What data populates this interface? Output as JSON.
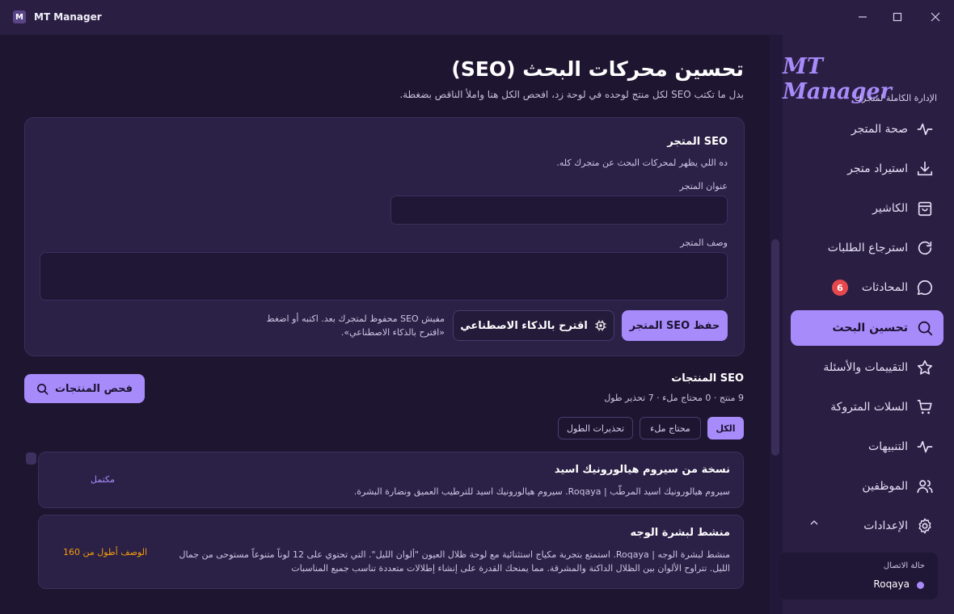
{
  "window": {
    "app_title": "MT Manager",
    "logo_letter": "M",
    "min_glyph": "—",
    "max_glyph": "☐",
    "close_glyph": "✕"
  },
  "page": {
    "title": "تحسين محركات البحث (SEO)",
    "subtitle": "بدل ما تكتب SEO لكل منتج لوحده في لوحة زد، افحص الكل هنا واملأ الناقص بضغطة."
  },
  "store_seo": {
    "title": "SEO المتجر",
    "description": "ده اللي يظهر لمحركات البحث عن متجرك كله.",
    "store_title_label": "عنوان المتجر",
    "store_title_value": "",
    "store_desc_label": "وصف المتجر",
    "store_desc_value": "",
    "save_button": "حفظ SEO المتجر",
    "ai_button": "اقترح بالذكاء الاصطناعي",
    "hint": "مفيش SEO محفوظ لمتجرك بعد. اكتبه أو اضغط «اقترح بالذكاء الاصطناعي»."
  },
  "products_seo": {
    "title": "SEO المنتجات",
    "stats": "9 منتج · 0 محتاج ملء · 7 تحذير طول",
    "scan_button": "فحص المنتجات",
    "filters": [
      "الكل",
      "محتاج ملء",
      "تحذيرات الطول"
    ],
    "active_filter": "الكل",
    "items": [
      {
        "title": "نسخة من سيروم هيالورونيك اسيد",
        "desc": "سيروم هيالورونيك اسيد المرطّب | Roqaya. سيروم هيالورونيك اسيد للترطيب العميق ونضارة البشرة.",
        "status": "مكتمل"
      },
      {
        "title": "منشط لبشرة الوجه",
        "desc": "منشط لبشرة الوجه | Roqaya. استمتع بتجربة مكياج استثنائية مع لوحة ظلال العيون \"ألوان الليل\". التي تحتوي على 12 لوناً متنوعاً مستوحى من جمال الليل. تتراوح الألوان بين الظلال الداكنة والمشرقة. مما يمنحك القدرة على إنشاء إطلالات متعددة تناسب جميع المناسبات",
        "status": "الوصف أطول من 160"
      }
    ]
  },
  "sidebar": {
    "brand": "MT Manager",
    "brand_sub": "الإدارة الكاملة لمتجرك",
    "items": [
      {
        "label": "صحة المتجر",
        "icon": "activity-icon"
      },
      {
        "label": "استيراد متجر",
        "icon": "download-icon"
      },
      {
        "label": "الكاشير",
        "icon": "shopping-bag-icon"
      },
      {
        "label": "استرجاع الطلبات",
        "icon": "refresh-icon"
      },
      {
        "label": "المحادثات",
        "icon": "chat-icon",
        "badge": "6"
      },
      {
        "label": "تحسين البحث",
        "icon": "search-icon",
        "active": true
      },
      {
        "label": "التقييمات والأسئلة",
        "icon": "star-icon"
      },
      {
        "label": "السلات المتروكة",
        "icon": "cart-icon"
      },
      {
        "label": "التنبيهات",
        "icon": "pulse-icon"
      },
      {
        "label": "الموظفين",
        "icon": "users-icon"
      },
      {
        "label": "الإعدادات",
        "icon": "gear-icon"
      }
    ],
    "chevron_glyph": "^",
    "connection": {
      "label": "حالة الاتصال",
      "name": "Roqaya",
      "status_color": "#a78bfa"
    }
  },
  "colors": {
    "accent": "#a78bfa",
    "background": "#1e1530",
    "sidebar": "#2a1f42",
    "badge": "#e5484d",
    "warning": "#f59e0b"
  }
}
